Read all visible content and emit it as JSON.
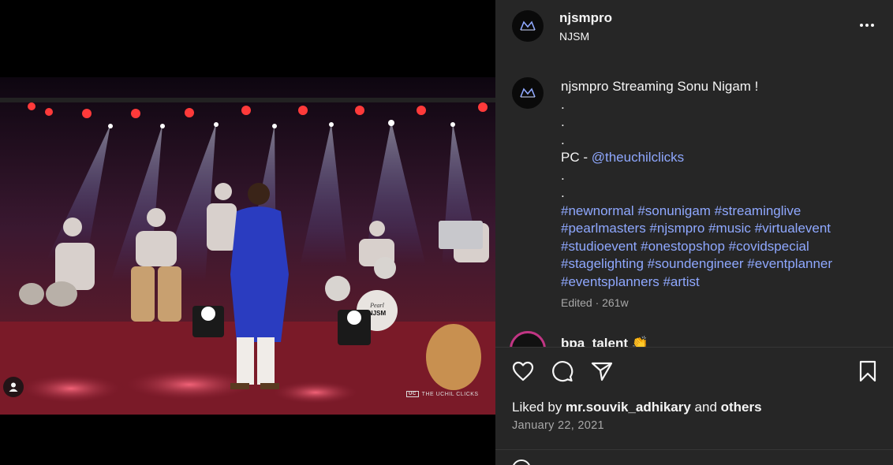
{
  "post": {
    "username": "njsmpro",
    "subtitle": "NJSM",
    "caption": {
      "username": "njsmpro",
      "text": "Streaming Sonu Nigam !",
      "dots1": [
        ".",
        ".",
        "."
      ],
      "credit_prefix": "PC - ",
      "credit_handle": "@theuchilclicks",
      "dots2": [
        ".",
        "."
      ],
      "hashtag_lines": [
        "#newnormal #sonunigam #streaminglive",
        "#pearlmasters #njsmpro #music #virtualevent",
        "#studioevent #onestopshop #covidspecial",
        "#stagelighting #soundengineer #eventplanner",
        "#eventsplanners #artist"
      ]
    },
    "edited_label": "Edited · 261w",
    "comment_preview": {
      "username": "bpa_talent",
      "emoji": "👏"
    },
    "likes": {
      "prefix": "Liked by ",
      "user": "mr.souvik_adhikary",
      "middle": " and ",
      "others": "others"
    },
    "date": "January 22, 2021"
  },
  "photo": {
    "watermark": "THE UCHIL CLICKS",
    "watermark_logo": "UC",
    "drum_label": "NJSM",
    "drum_brand": "Pearl"
  },
  "icons": {
    "more": "more-options-icon",
    "like": "heart-icon",
    "comment": "comment-icon",
    "share": "share-icon",
    "save": "bookmark-icon",
    "tag": "user-tag-icon"
  },
  "colors": {
    "panel_bg": "#262626",
    "text": "#f5f5f5",
    "muted": "#a8a8a8",
    "link": "#8fa8ff"
  }
}
